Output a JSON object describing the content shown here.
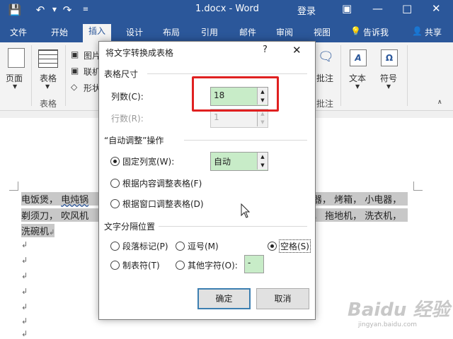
{
  "titlebar": {
    "title": "1.docx - Word",
    "login": "登录"
  },
  "tabs": [
    "文件",
    "开始",
    "插入",
    "设计",
    "布局",
    "引用",
    "邮件",
    "审阅",
    "视图",
    "告诉我",
    "共享"
  ],
  "ribbon": {
    "page_label": "页面",
    "table_label": "表格",
    "group_table": "表格",
    "pic_label": "图片",
    "online_label": "联机",
    "shape_label": "形状",
    "comment_label": "批注",
    "group_comment": "批注",
    "text_label": "文本",
    "symbol_label": "符号"
  },
  "document": {
    "line1_a": "电饭煲，",
    "line1_b": "电炖锅",
    "line1_right": "器，  烤箱，  小电器，",
    "line2_a": "剃须刀，  吹风机",
    "line2_right": "，  拖地机，  洗衣机，",
    "line3": "洗碗机"
  },
  "dialog": {
    "title": "将文字转换成表格",
    "help": "?",
    "close": "✕",
    "section_size": "表格尺寸",
    "cols_label": "列数(C):",
    "cols_value": "18",
    "rows_label": "行数(R):",
    "rows_value": "1",
    "section_autofit": "“自动调整”操作",
    "fixed_label": "固定列宽(W):",
    "fixed_value": "自动",
    "content_label": "根据内容调整表格(F)",
    "window_label": "根据窗口调整表格(D)",
    "section_sep": "文字分隔位置",
    "sep_para": "段落标记(P)",
    "sep_comma": "逗号(M)",
    "sep_space": "空格(S)",
    "sep_tab": "制表符(T)",
    "sep_other": "其他字符(O):",
    "sep_other_value": "-",
    "ok": "确定",
    "cancel": "取消"
  },
  "watermark": {
    "brand": "Baidu 经验",
    "url": "jingyan.baidu.com"
  }
}
